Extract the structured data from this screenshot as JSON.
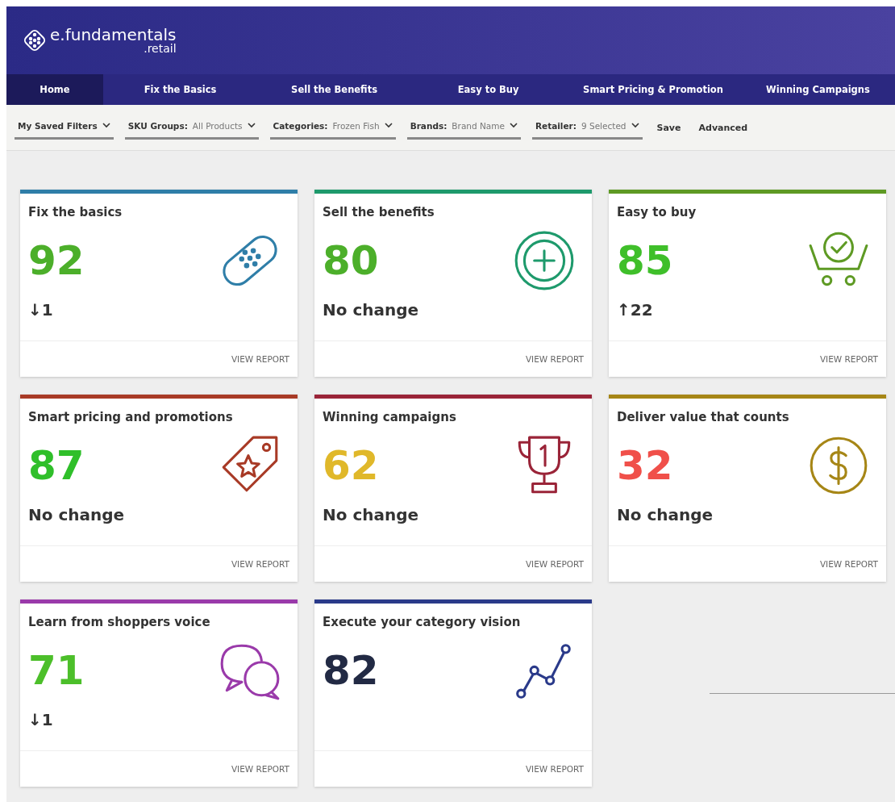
{
  "brand": {
    "name": "e.fundamentals",
    "suffix": ".retail"
  },
  "nav": [
    {
      "label": "Home",
      "selected": true
    },
    {
      "label": "Fix the Basics",
      "selected": false
    },
    {
      "label": "Sell the Benefits",
      "selected": false
    },
    {
      "label": "Easy to Buy",
      "selected": false
    },
    {
      "label": "Smart Pricing & Promotion",
      "selected": false
    },
    {
      "label": "Winning Campaigns",
      "selected": false
    }
  ],
  "filters": [
    {
      "label": "My Saved Filters"
    },
    {
      "label": "SKU Groups:",
      "value": "All Products"
    },
    {
      "label": "Categories:",
      "value": "Frozen Fish"
    },
    {
      "label": "Brands:",
      "value": "Brand Name"
    },
    {
      "label": "Retailer:",
      "value": "9 Selected"
    }
  ],
  "actions": [
    "Save",
    "Advanced"
  ],
  "cards": [
    {
      "title": "Fix the basics",
      "score": "92",
      "change": "↓1",
      "color": "#2f7ea8",
      "link": "VIEW REPORT"
    },
    {
      "title": "Sell the benefits",
      "score": "80",
      "change": "No change",
      "color": "#1e9a6c",
      "link": "VIEW REPORT"
    },
    {
      "title": "Easy to buy",
      "score": "85",
      "change": "↑22",
      "color": "#5e9a24",
      "link": "VIEW REPORT"
    },
    {
      "title": "Smart pricing and promotions",
      "score": "87",
      "change": "No change",
      "color": "#a83a26",
      "link": "VIEW REPORT"
    },
    {
      "title": "Winning campaigns",
      "score": "62",
      "change": "No change",
      "color": "#9a2438",
      "link": "VIEW REPORT"
    },
    {
      "title": "Deliver value that counts",
      "score": "32",
      "change": "No change",
      "color": "#a68616",
      "link": "VIEW REPORT"
    },
    {
      "title": "Learn from shoppers voice",
      "score": "71",
      "change": "↓1",
      "color": "#9a3aaa",
      "link": "VIEW REPORT"
    },
    {
      "title": "Execute your category vision",
      "score": "82",
      "color": "#2a3a8a",
      "link": "VIEW REPORT"
    }
  ]
}
